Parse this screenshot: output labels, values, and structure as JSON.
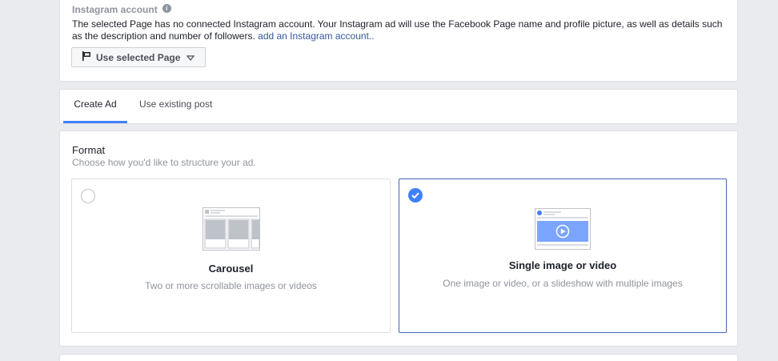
{
  "instagram": {
    "title": "Instagram account",
    "info_icon": "i",
    "description": "The selected Page has no connected Instagram account. Your Instagram ad will use the Facebook Page name and profile picture, as well as details such as the description and number of followers.",
    "link_text": "add an Instagram account..",
    "dropdown_label": "Use selected Page",
    "dropdown_icon": "flag-icon"
  },
  "tabs": [
    {
      "label": "Create Ad",
      "active": true
    },
    {
      "label": "Use existing post",
      "active": false
    }
  ],
  "format": {
    "title": "Format",
    "subtitle": "Choose how you'd like to structure your ad.",
    "options": [
      {
        "name": "Carousel",
        "description": "Two or more scrollable images or videos",
        "selected": false
      },
      {
        "name": "Single image or video",
        "description": "One image or video, or a slideshow with multiple images",
        "selected": true
      }
    ]
  },
  "colors": {
    "accent": "#4080ff",
    "selected_border": "#4267b2",
    "link": "#365899",
    "muted_text": "#90949c",
    "background": "#e9ebee"
  }
}
